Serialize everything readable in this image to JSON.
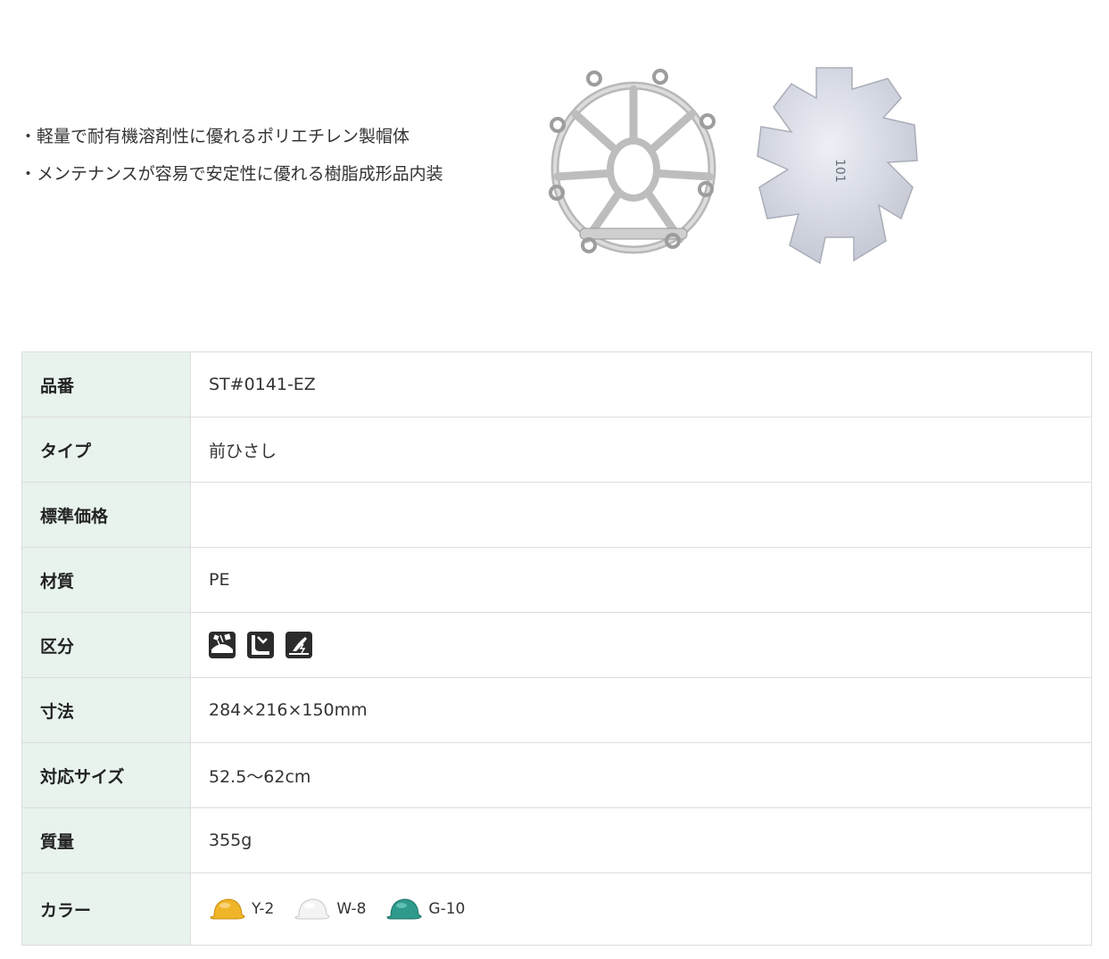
{
  "features": [
    "軽量で耐有機溶剤性に優れるポリエチレン製帽体",
    "メンテナンスが容易で安定性に優れる樹脂成形品内装"
  ],
  "images": {
    "suspension_alt": "ハンモック内装",
    "liner_alt": "衝撃吸収ライナー",
    "liner_marking": "101"
  },
  "spec": {
    "rows": [
      {
        "label": "品番",
        "value": "ST#0141-EZ"
      },
      {
        "label": "タイプ",
        "value": "前ひさし"
      },
      {
        "label": "標準価格",
        "value": ""
      },
      {
        "label": "材質",
        "value": "PE"
      },
      {
        "label": "区分",
        "value": ""
      },
      {
        "label": "寸法",
        "value": "284×216×150mm"
      },
      {
        "label": "対応サイズ",
        "value": "52.5〜62cm"
      },
      {
        "label": "質量",
        "value": "355g"
      },
      {
        "label": "カラー",
        "value": ""
      }
    ],
    "category_icons": [
      "falling-object-icon",
      "fall-protection-icon",
      "electrical-icon"
    ],
    "colors": [
      {
        "code": "Y-2",
        "hex": "#f0b428"
      },
      {
        "code": "W-8",
        "hex": "#f4f4f4"
      },
      {
        "code": "G-10",
        "hex": "#2e9a8c"
      }
    ]
  },
  "theme": {
    "header_bg": "#e8f3ed",
    "border": "#dddddd",
    "text": "#333333"
  }
}
